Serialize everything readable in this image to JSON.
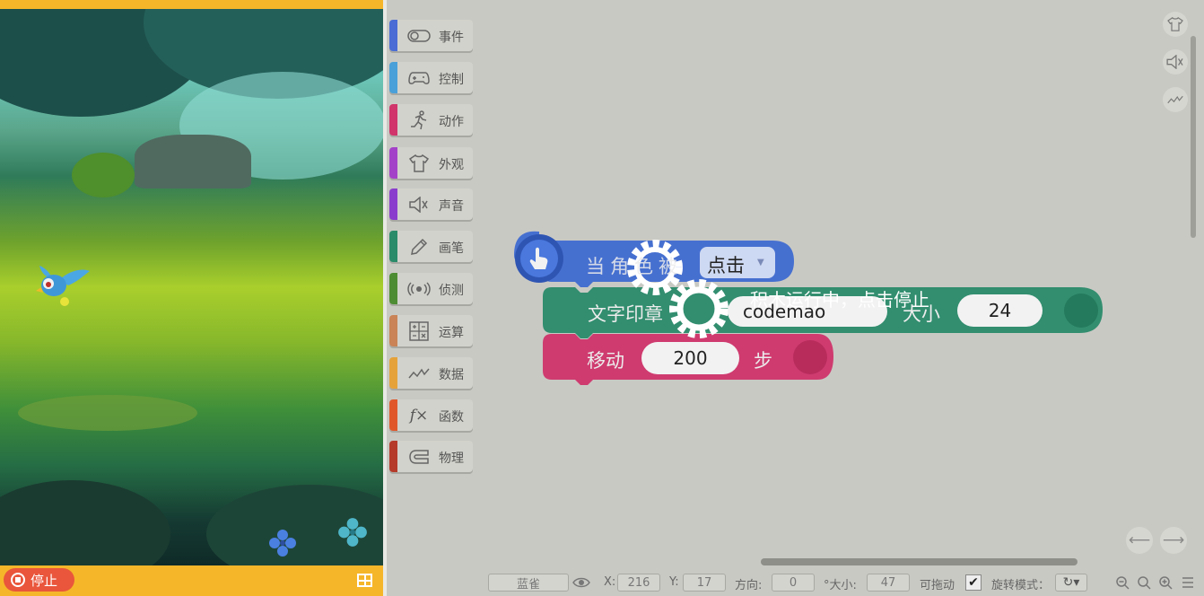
{
  "stage": {
    "stop_label": "停止",
    "fullscreen_icon": "fullscreen-icon"
  },
  "categories": [
    {
      "label": "事件",
      "color": "#4a6cd4",
      "icon": "toggle-icon"
    },
    {
      "label": "控制",
      "color": "#4aa0d8",
      "icon": "gamepad-icon"
    },
    {
      "label": "动作",
      "color": "#d0346a",
      "icon": "runner-icon"
    },
    {
      "label": "外观",
      "color": "#a341c8",
      "icon": "shirt-icon"
    },
    {
      "label": "声音",
      "color": "#8a3dcc",
      "icon": "speaker-icon"
    },
    {
      "label": "画笔",
      "color": "#2a8b6a",
      "icon": "pencil-icon"
    },
    {
      "label": "侦测",
      "color": "#4e8c33",
      "icon": "radar-icon"
    },
    {
      "label": "运算",
      "color": "#c98356",
      "icon": "calculator-icon"
    },
    {
      "label": "数据",
      "color": "#e5a23a",
      "icon": "chart-icon"
    },
    {
      "label": "函数",
      "color": "#e0582a",
      "icon": "function-icon"
    },
    {
      "label": "物理",
      "color": "#b53a2a",
      "icon": "magnet-icon"
    }
  ],
  "blocks": {
    "event_block": {
      "text": "当角色被",
      "dropdown_value": "点击",
      "color": "#3f6bd1"
    },
    "print_block": {
      "text": "文字印章",
      "text_value": "codemao",
      "size_label": "大小",
      "size_value": "24",
      "color": "#2a8b6a"
    },
    "move_block": {
      "text": "移动",
      "steps_value": "200",
      "steps_label": "步",
      "color": "#d0346a"
    }
  },
  "overlay": {
    "running_text": "积木运行中，点击停止"
  },
  "statusbar": {
    "sprite_name": "蓝雀",
    "x_label": "X:",
    "x_value": "216",
    "y_label": "Y:",
    "y_value": "17",
    "direction_label": "方向:",
    "direction_value": "0",
    "size_label": "°大小:",
    "size_value": "47",
    "draggable_label": "可拖动",
    "rotate_mode_label": "旋转模式："
  }
}
